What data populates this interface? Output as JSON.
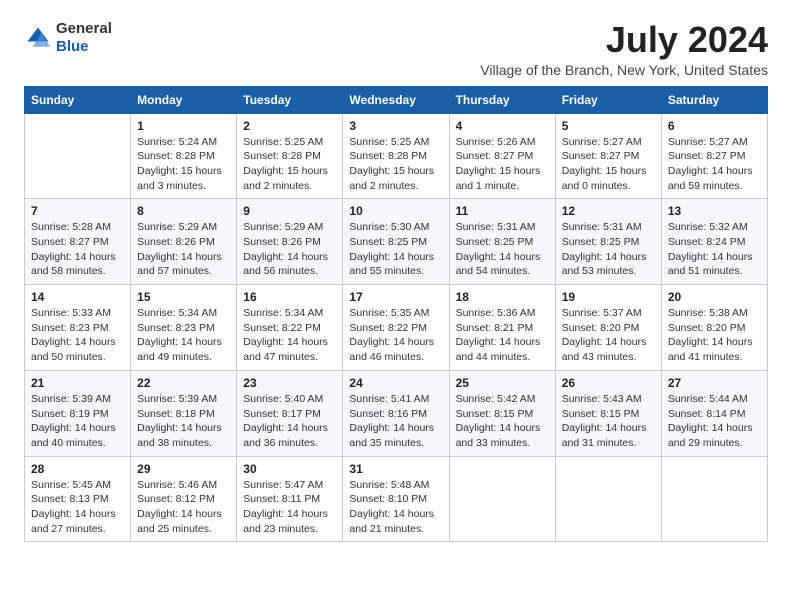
{
  "logo": {
    "general": "General",
    "blue": "Blue"
  },
  "title": "July 2024",
  "location": "Village of the Branch, New York, United States",
  "weekdays": [
    "Sunday",
    "Monday",
    "Tuesday",
    "Wednesday",
    "Thursday",
    "Friday",
    "Saturday"
  ],
  "weeks": [
    [
      {
        "day": "",
        "info": ""
      },
      {
        "day": "1",
        "info": "Sunrise: 5:24 AM\nSunset: 8:28 PM\nDaylight: 15 hours\nand 3 minutes."
      },
      {
        "day": "2",
        "info": "Sunrise: 5:25 AM\nSunset: 8:28 PM\nDaylight: 15 hours\nand 2 minutes."
      },
      {
        "day": "3",
        "info": "Sunrise: 5:25 AM\nSunset: 8:28 PM\nDaylight: 15 hours\nand 2 minutes."
      },
      {
        "day": "4",
        "info": "Sunrise: 5:26 AM\nSunset: 8:27 PM\nDaylight: 15 hours\nand 1 minute."
      },
      {
        "day": "5",
        "info": "Sunrise: 5:27 AM\nSunset: 8:27 PM\nDaylight: 15 hours\nand 0 minutes."
      },
      {
        "day": "6",
        "info": "Sunrise: 5:27 AM\nSunset: 8:27 PM\nDaylight: 14 hours\nand 59 minutes."
      }
    ],
    [
      {
        "day": "7",
        "info": "Sunrise: 5:28 AM\nSunset: 8:27 PM\nDaylight: 14 hours\nand 58 minutes."
      },
      {
        "day": "8",
        "info": "Sunrise: 5:29 AM\nSunset: 8:26 PM\nDaylight: 14 hours\nand 57 minutes."
      },
      {
        "day": "9",
        "info": "Sunrise: 5:29 AM\nSunset: 8:26 PM\nDaylight: 14 hours\nand 56 minutes."
      },
      {
        "day": "10",
        "info": "Sunrise: 5:30 AM\nSunset: 8:25 PM\nDaylight: 14 hours\nand 55 minutes."
      },
      {
        "day": "11",
        "info": "Sunrise: 5:31 AM\nSunset: 8:25 PM\nDaylight: 14 hours\nand 54 minutes."
      },
      {
        "day": "12",
        "info": "Sunrise: 5:31 AM\nSunset: 8:25 PM\nDaylight: 14 hours\nand 53 minutes."
      },
      {
        "day": "13",
        "info": "Sunrise: 5:32 AM\nSunset: 8:24 PM\nDaylight: 14 hours\nand 51 minutes."
      }
    ],
    [
      {
        "day": "14",
        "info": "Sunrise: 5:33 AM\nSunset: 8:23 PM\nDaylight: 14 hours\nand 50 minutes."
      },
      {
        "day": "15",
        "info": "Sunrise: 5:34 AM\nSunset: 8:23 PM\nDaylight: 14 hours\nand 49 minutes."
      },
      {
        "day": "16",
        "info": "Sunrise: 5:34 AM\nSunset: 8:22 PM\nDaylight: 14 hours\nand 47 minutes."
      },
      {
        "day": "17",
        "info": "Sunrise: 5:35 AM\nSunset: 8:22 PM\nDaylight: 14 hours\nand 46 minutes."
      },
      {
        "day": "18",
        "info": "Sunrise: 5:36 AM\nSunset: 8:21 PM\nDaylight: 14 hours\nand 44 minutes."
      },
      {
        "day": "19",
        "info": "Sunrise: 5:37 AM\nSunset: 8:20 PM\nDaylight: 14 hours\nand 43 minutes."
      },
      {
        "day": "20",
        "info": "Sunrise: 5:38 AM\nSunset: 8:20 PM\nDaylight: 14 hours\nand 41 minutes."
      }
    ],
    [
      {
        "day": "21",
        "info": "Sunrise: 5:39 AM\nSunset: 8:19 PM\nDaylight: 14 hours\nand 40 minutes."
      },
      {
        "day": "22",
        "info": "Sunrise: 5:39 AM\nSunset: 8:18 PM\nDaylight: 14 hours\nand 38 minutes."
      },
      {
        "day": "23",
        "info": "Sunrise: 5:40 AM\nSunset: 8:17 PM\nDaylight: 14 hours\nand 36 minutes."
      },
      {
        "day": "24",
        "info": "Sunrise: 5:41 AM\nSunset: 8:16 PM\nDaylight: 14 hours\nand 35 minutes."
      },
      {
        "day": "25",
        "info": "Sunrise: 5:42 AM\nSunset: 8:15 PM\nDaylight: 14 hours\nand 33 minutes."
      },
      {
        "day": "26",
        "info": "Sunrise: 5:43 AM\nSunset: 8:15 PM\nDaylight: 14 hours\nand 31 minutes."
      },
      {
        "day": "27",
        "info": "Sunrise: 5:44 AM\nSunset: 8:14 PM\nDaylight: 14 hours\nand 29 minutes."
      }
    ],
    [
      {
        "day": "28",
        "info": "Sunrise: 5:45 AM\nSunset: 8:13 PM\nDaylight: 14 hours\nand 27 minutes."
      },
      {
        "day": "29",
        "info": "Sunrise: 5:46 AM\nSunset: 8:12 PM\nDaylight: 14 hours\nand 25 minutes."
      },
      {
        "day": "30",
        "info": "Sunrise: 5:47 AM\nSunset: 8:11 PM\nDaylight: 14 hours\nand 23 minutes."
      },
      {
        "day": "31",
        "info": "Sunrise: 5:48 AM\nSunset: 8:10 PM\nDaylight: 14 hours\nand 21 minutes."
      },
      {
        "day": "",
        "info": ""
      },
      {
        "day": "",
        "info": ""
      },
      {
        "day": "",
        "info": ""
      }
    ]
  ]
}
